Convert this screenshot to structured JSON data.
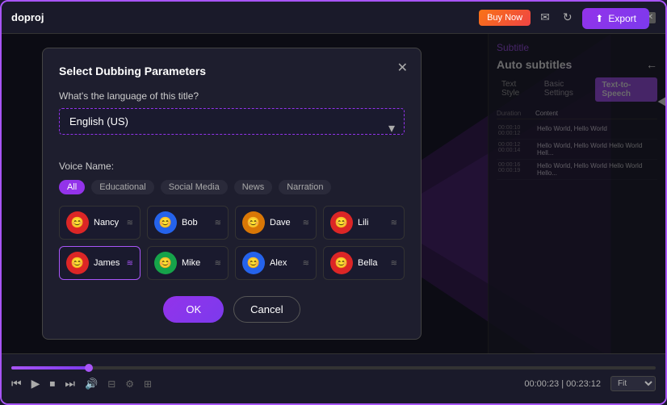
{
  "app": {
    "logo": "doproj",
    "title": "doproj"
  },
  "header": {
    "buy_now": "Buy Now",
    "export_label": "Export"
  },
  "background": {
    "subtitle_header": "Subtitle",
    "auto_subtitles": "Auto subtitles",
    "tabs": [
      "Text Style",
      "Basic Settings",
      "Text-to-Speech"
    ],
    "table_headers": [
      "Duration",
      "Content"
    ],
    "rows": [
      {
        "time": "00:00:10\n00:00:12",
        "content": "Hello World, Hello World"
      },
      {
        "time": "00:00:12\n00:00:14",
        "content": "Hello World, Hello World\nHello World Hello World Hell..."
      },
      {
        "time": "00:00:16\n00:00:19",
        "content": "Hello World, Hello World\nHello World Hello World Hello..."
      }
    ]
  },
  "dialog": {
    "title": "Select Dubbing Parameters",
    "language_label": "What's the language of this title?",
    "language_value": "English (US)",
    "voice_name_label": "Voice Name:",
    "filters": [
      "All",
      "Educational",
      "Social Media",
      "News",
      "Narration"
    ],
    "active_filter": "All",
    "voices": [
      {
        "name": "Nancy",
        "avatar_color": "red",
        "selected": false
      },
      {
        "name": "Bob",
        "avatar_color": "blue",
        "selected": false
      },
      {
        "name": "Dave",
        "avatar_color": "orange",
        "selected": false
      },
      {
        "name": "Lili",
        "avatar_color": "red",
        "selected": false
      },
      {
        "name": "James",
        "avatar_color": "red",
        "selected": true
      },
      {
        "name": "Mike",
        "avatar_color": "green",
        "selected": false
      },
      {
        "name": "Alex",
        "avatar_color": "blue",
        "selected": false
      },
      {
        "name": "Bella",
        "avatar_color": "red",
        "selected": false
      }
    ],
    "ok_label": "OK",
    "cancel_label": "Cancel"
  },
  "player": {
    "current_time": "00:00:23",
    "total_time": "00:23:12",
    "zoom": "Fit",
    "progress_percent": 12
  }
}
